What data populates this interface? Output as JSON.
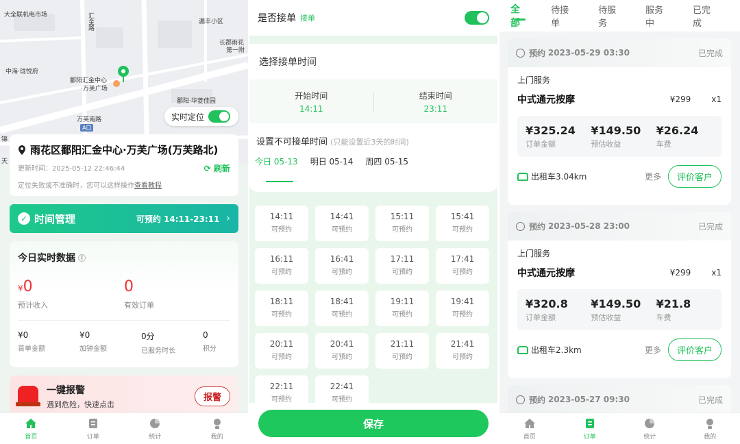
{
  "colors": {
    "accent": "#21c15c",
    "alert": "#e33333",
    "time_bar": "#1ec98a"
  },
  "home": {
    "map": {
      "labels": [
        "大全联机电市场",
        "汇金路",
        "漏丰小区",
        "长郡雨花",
        "第一附",
        "中海·珑悦府",
        "鄱阳汇金中心",
        "·万芙广场",
        "鄱阳·华菱佳园",
        "万芙南路",
        "A口",
        "锦",
        "天"
      ],
      "realtime_location_label": "实时定位",
      "realtime_location_on": true
    },
    "address": {
      "title": "雨花区鄱阳汇金中心·万芙广场(万芙路北)",
      "updated": "更新时间：2025-05-12 22:46:44",
      "refresh_label": "刷新",
      "hint_prefix": "定位失败或不准确时，您可以这样操作",
      "hint_link": "查看教程"
    },
    "time_mgmt": {
      "title": "时间管理",
      "range": "可预约 14:11-23:11"
    },
    "today_stats": {
      "title": "今日实时数据",
      "income_symbol": "¥",
      "income_value": "0",
      "income_label": "预计收入",
      "orders_value": "0",
      "orders_label": "有效订单",
      "small": [
        {
          "value": "¥0",
          "label": "首单金额"
        },
        {
          "value": "¥0",
          "label": "加钟金额"
        },
        {
          "value": "0分",
          "label": "已服务时长"
        },
        {
          "value": "0",
          "label": "积分"
        }
      ]
    },
    "alarm": {
      "title": "一键报警",
      "subtitle": "遇到危险，快速点击",
      "button": "报警"
    }
  },
  "tabbar": {
    "home": "首页",
    "orders": "订单",
    "stats": "统计",
    "mine": "我的"
  },
  "schedule": {
    "accept_label": "是否接单",
    "accept_status": "接单",
    "accept_on": true,
    "choose_time_title": "选择接单时间",
    "start_label": "开始时间",
    "start_value": "14:11",
    "end_label": "结束时间",
    "end_value": "23:11",
    "unavailable_title": "设置不可接单时间",
    "unavailable_note": "(只能设置近3天的时间)",
    "days": [
      "今日 05-13",
      "明日 05-14",
      "周四 05-15"
    ],
    "slots": [
      {
        "time": "14:11",
        "status": "可预约"
      },
      {
        "time": "14:41",
        "status": "可预约"
      },
      {
        "time": "15:11",
        "status": "可预约"
      },
      {
        "time": "15:41",
        "status": "可预约"
      },
      {
        "time": "16:11",
        "status": "可预约"
      },
      {
        "time": "16:41",
        "status": "可预约"
      },
      {
        "time": "17:11",
        "status": "可预约"
      },
      {
        "time": "17:41",
        "status": "可预约"
      },
      {
        "time": "18:11",
        "status": "可预约"
      },
      {
        "time": "18:41",
        "status": "可预约"
      },
      {
        "time": "19:11",
        "status": "可预约"
      },
      {
        "time": "19:41",
        "status": "可预约"
      },
      {
        "time": "20:11",
        "status": "可预约"
      },
      {
        "time": "20:41",
        "status": "可预约"
      },
      {
        "time": "21:11",
        "status": "可预约"
      },
      {
        "time": "21:41",
        "status": "可预约"
      },
      {
        "time": "22:11",
        "status": "可预约"
      },
      {
        "time": "22:41",
        "status": "可预约"
      }
    ],
    "save_label": "保存"
  },
  "orders": {
    "tabs": [
      "全部",
      "待接单",
      "待服务",
      "服务中",
      "已完成"
    ],
    "list": [
      {
        "prefix": "预约",
        "datetime": "2023-05-29 03:30",
        "status": "已完成",
        "service_type": "上门服务",
        "name": "中式通元按摩",
        "price": "¥299",
        "qty": "x1",
        "total": "¥325.24",
        "total_label": "订单金额",
        "income": "¥149.50",
        "income_label": "预估收益",
        "fare": "¥26.24",
        "fare_label": "车费",
        "transport": "出租车3.04km",
        "more": "更多",
        "rate": "评价客户"
      },
      {
        "prefix": "预约",
        "datetime": "2023-05-28 23:00",
        "status": "已完成",
        "service_type": "上门服务",
        "name": "中式通元按摩",
        "price": "¥299",
        "qty": "x1",
        "total": "¥320.8",
        "total_label": "订单金额",
        "income": "¥149.50",
        "income_label": "预估收益",
        "fare": "¥21.8",
        "fare_label": "车费",
        "transport": "出租车2.3km",
        "more": "更多",
        "rate": "评价客户"
      },
      {
        "prefix": "预约",
        "datetime": "2023-05-27 09:30",
        "status": "已完成"
      }
    ]
  }
}
